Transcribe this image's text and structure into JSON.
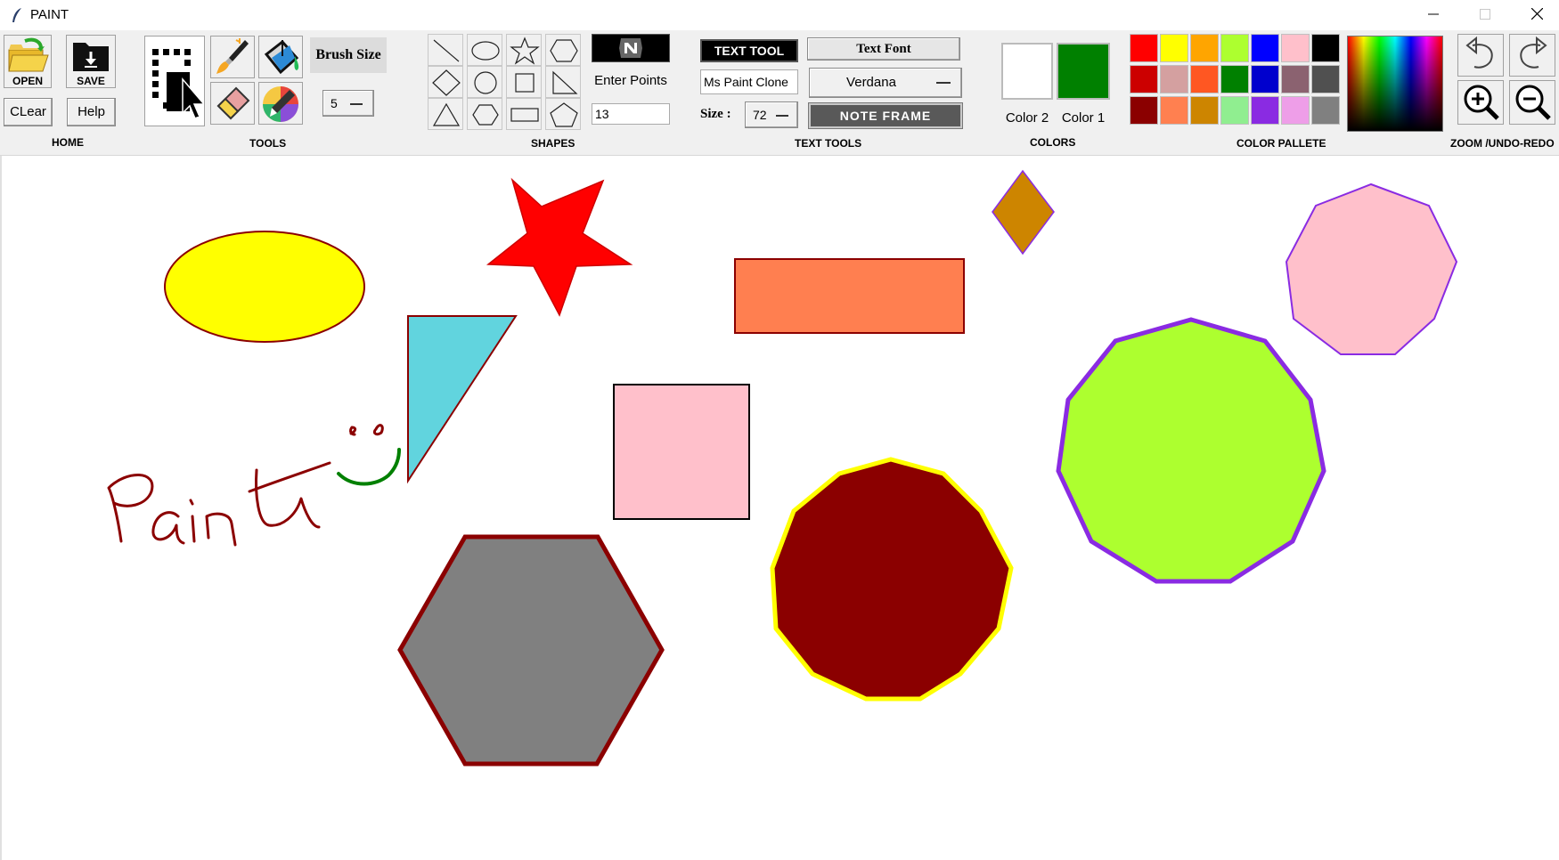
{
  "window": {
    "title": "PAINT",
    "minimize_icon": "minimize-icon",
    "maximize_icon": "maximize-icon",
    "close_icon": "close-icon"
  },
  "home": {
    "label": "HOME",
    "open_label": "OPEN",
    "save_label": "SAVE",
    "clear_label": "CLear",
    "help_label": "Help"
  },
  "tools": {
    "label": "TOOLS",
    "brush_size_label": "Brush Size",
    "brush_size_value": "5",
    "items": [
      "select-icon",
      "brush-icon",
      "fill-bucket-icon",
      "eraser-icon",
      "color-picker-icon"
    ]
  },
  "shapes": {
    "label": "SHAPES",
    "enter_points_label": "Enter Points",
    "points_value": "13",
    "items": [
      "line",
      "oval",
      "star",
      "hexagon",
      "diamond",
      "circle",
      "square",
      "right-triangle",
      "triangle",
      "hexagon-flat",
      "rectangle",
      "pentagon"
    ]
  },
  "text_tools": {
    "label": "TEXT TOOLS",
    "text_tool_label": "TEXT TOOL",
    "text_value": "Ms Paint Clone",
    "text_font_label": "Text Font",
    "font_value": "Verdana",
    "size_label": "Size :",
    "size_value": "72",
    "note_frame_label": "NOTE FRAME"
  },
  "colors": {
    "label": "COLORS",
    "color2_label": "Color 2",
    "color1_label": "Color 1",
    "color2": "#ffffff",
    "color1": "#008000"
  },
  "palette": {
    "label": "COLOR PALLETE",
    "rows": [
      [
        "#ff0000",
        "#ffff00",
        "#ffa500",
        "#adff2f",
        "#0000ff",
        "#ffc0cb",
        "#000000"
      ],
      [
        "#cc0000",
        "#d4a0a0",
        "#ff5722",
        "#008000",
        "#0000cd",
        "#8b6270",
        "#505050"
      ],
      [
        "#8b0000",
        "#ff8050",
        "#cd8500",
        "#90ee90",
        "#8a2be2",
        "#ee9ee8",
        "#808080"
      ]
    ]
  },
  "zoom": {
    "label": "ZOOM /UNDO-REDO",
    "items": [
      "undo-icon",
      "redo-icon",
      "zoom-in-icon",
      "zoom-out-icon"
    ]
  },
  "canvas": {
    "handwriting": "Paint"
  }
}
